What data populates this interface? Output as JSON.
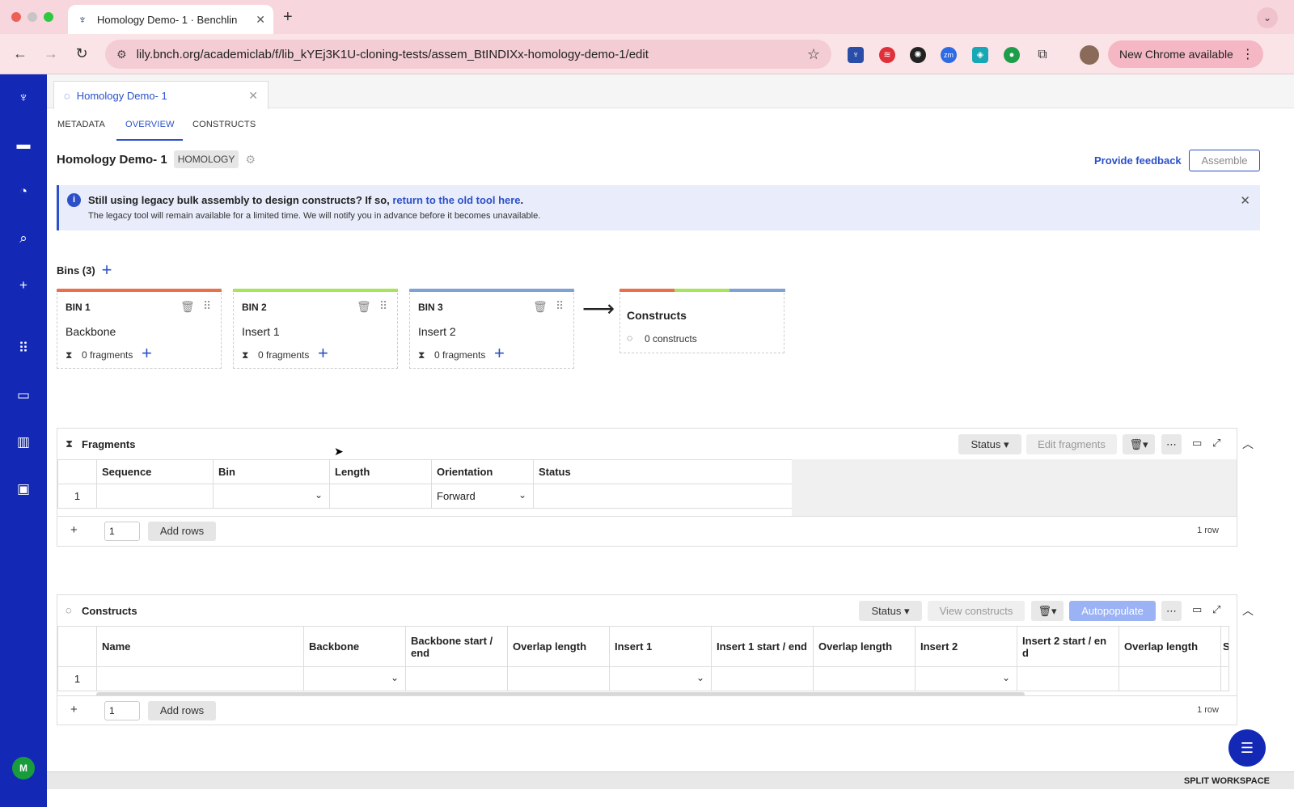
{
  "browser": {
    "tab_title": "Homology Demo- 1 · Benchlin",
    "url": "lily.bnch.org/academiclab/f/lib_kYEj3K1U-cloning-tests/assem_BtINDIXx-homology-demo-1/edit",
    "new_chrome_label": "New Chrome available"
  },
  "workspace": {
    "doc_tab_title": "Homology Demo- 1",
    "subnav": [
      "METADATA",
      "OVERVIEW",
      "CONSTRUCTS"
    ],
    "page_title": "Homology Demo- 1",
    "tag": "HOMOLOGY",
    "feedback_link": "Provide feedback",
    "assemble_label": "Assemble"
  },
  "banner": {
    "line1_prefix": "Still using legacy bulk assembly to design constructs? If so, ",
    "line1_link": "return to the old tool here",
    "line1_suffix": ".",
    "line2": "The legacy tool will remain available for a limited time. We will notify you in advance before it becomes unavailable."
  },
  "bins": {
    "header": "Bins (3)",
    "items": [
      {
        "code": "BIN 1",
        "name": "Backbone",
        "fragments": "0 fragments",
        "color": "#e8704a"
      },
      {
        "code": "BIN 2",
        "name": "Insert 1",
        "fragments": "0 fragments",
        "color": "#a9e25c"
      },
      {
        "code": "BIN 3",
        "name": "Insert 2",
        "fragments": "0 fragments",
        "color": "#7fa2d4"
      }
    ],
    "constructs_title": "Constructs",
    "constructs_count": "0 constructs"
  },
  "fragments_panel": {
    "title": "Fragments",
    "status_label": "Status",
    "edit_label": "Edit fragments",
    "columns": [
      "Sequence",
      "Bin",
      "Length",
      "Orientation",
      "Status"
    ],
    "row_number": "1",
    "orientation_value": "Forward",
    "rows_input": "1",
    "add_rows_label": "Add rows",
    "row_count": "1 row"
  },
  "constructs_panel": {
    "title": "Constructs",
    "status_label": "Status",
    "view_label": "View constructs",
    "autopopulate_label": "Autopopulate",
    "columns": [
      "Name",
      "Backbone",
      "Backbone start / end",
      "Overlap length",
      "Insert 1",
      "Insert 1 start / end",
      "Overlap length",
      "Insert 2",
      "Insert 2 start / en d",
      "Overlap length",
      "S"
    ],
    "row_number": "1",
    "rows_input": "1",
    "add_rows_label": "Add rows",
    "row_count": "1 row"
  },
  "sidebar": {
    "avatar_initial": "M"
  },
  "footer": {
    "split_label": "SPLIT WORKSPACE"
  },
  "colors": {
    "accent": "#2b50c8",
    "sidebar": "#1329b6"
  }
}
